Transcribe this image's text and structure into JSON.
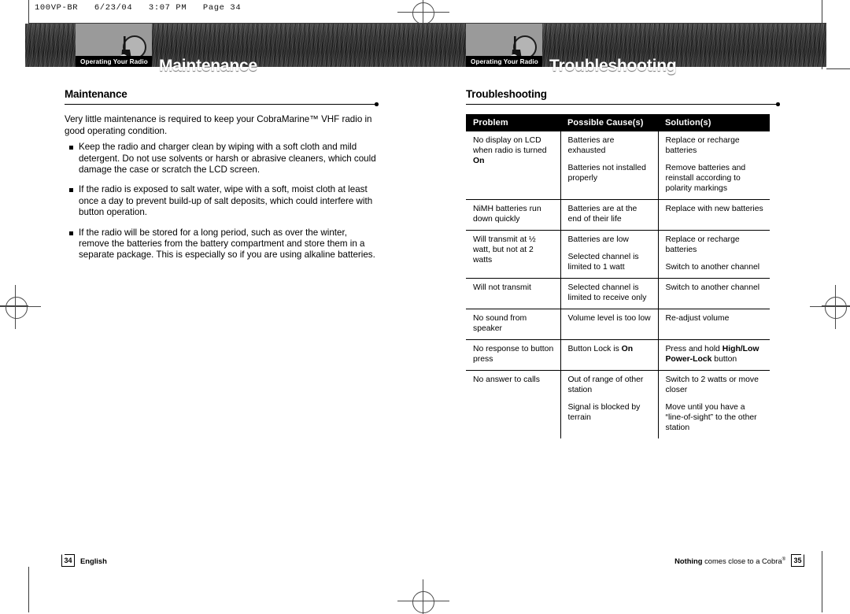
{
  "slug": {
    "text": "100VP-BR   6/23/04   3:07 PM   Page 34"
  },
  "left_page": {
    "tab_label": "Operating Your Radio",
    "banner_title": "Maintenance",
    "section_heading": "Maintenance",
    "intro": "Very little maintenance is required to keep your CobraMarine™ VHF radio in good operating condition.",
    "bullets": [
      "Keep the radio and charger clean by wiping with a soft cloth and mild detergent. Do not use solvents or harsh or abrasive cleaners, which could damage the case or scratch the LCD screen.",
      "If the radio is exposed to salt water, wipe with a soft, moist cloth at least once a day to prevent build-up of salt deposits, which could interfere with button operation.",
      "If the radio will be stored for a long period, such as over the winter, remove the batteries from the battery compartment and store them in a separate package. This is especially so if you are using alkaline batteries."
    ],
    "footer": {
      "page_number": "34",
      "label": "English"
    }
  },
  "right_page": {
    "tab_label": "Operating Your Radio",
    "banner_title": "Troubleshooting",
    "section_heading": "Troubleshooting",
    "table": {
      "columns": [
        "Problem",
        "Possible Cause(s)",
        "Solution(s)"
      ],
      "rows": [
        {
          "problem": "No display on LCD when radio is turned On",
          "problem_bold_tail": "On",
          "causes": [
            "Batteries are exhausted",
            "Batteries not installed properly"
          ],
          "solutions": [
            "Replace or recharge batteries",
            "Remove batteries and reinstall according to polarity markings"
          ]
        },
        {
          "problem": "NiMH batteries run down quickly",
          "causes": [
            "Batteries are at the end of their life"
          ],
          "solutions": [
            "Replace with new batteries"
          ]
        },
        {
          "problem": "Will transmit at ½ watt, but not at 2 watts",
          "causes": [
            "Batteries are low",
            "Selected channel is limited to 1 watt"
          ],
          "solutions": [
            "Replace or recharge batteries",
            "Switch to another channel"
          ]
        },
        {
          "problem": "Will not transmit",
          "causes": [
            "Selected channel is limited to receive only"
          ],
          "solutions": [
            "Switch to another channel"
          ]
        },
        {
          "problem": "No sound from speaker",
          "causes": [
            "Volume level is too low"
          ],
          "solutions": [
            "Re-adjust volume"
          ]
        },
        {
          "problem": "No response to button press",
          "causes": [
            "Button Lock is On"
          ],
          "causes_bold": "On",
          "solutions": [
            "Press and hold High/Low Power-Lock button"
          ],
          "solutions_bold": "High/Low Power-Lock"
        },
        {
          "problem": "No answer to calls",
          "causes": [
            "Out of range of other station",
            "Signal is blocked by terrain"
          ],
          "solutions": [
            "Switch to 2 watts or move closer",
            "Move until you have a “line-of-sight” to the other station"
          ]
        }
      ]
    },
    "footer": {
      "page_number": "35",
      "tagline_bold": "Nothing",
      "tagline_rest": " comes close to a Cobra",
      "tagline_sup": "®"
    }
  },
  "colors": {
    "banner_dark": "#333333",
    "tab_gray": "#9a9a9a",
    "header_black": "#000000",
    "paper": "#ffffff"
  }
}
